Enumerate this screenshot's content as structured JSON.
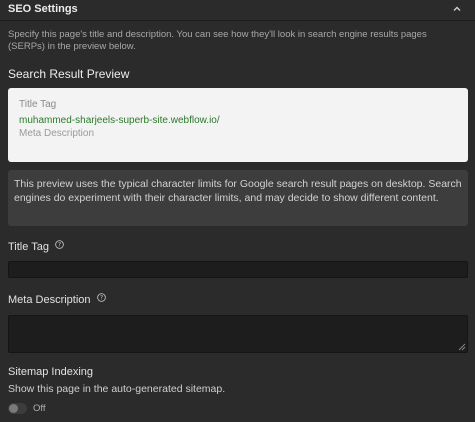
{
  "header": {
    "title": "SEO Settings",
    "collapse_icon": "chevron-up-icon"
  },
  "intro": {
    "text": "Specify this page's title and description. You can see how they'll look in search engine results pages (SERPs) in the preview below."
  },
  "preview": {
    "heading": "Search Result Preview",
    "title_tag": "Title Tag",
    "url": "muhammed-sharjeels-superb-site.webflow.io/",
    "meta_description": "Meta Description",
    "url_color": "#2a7a2a"
  },
  "note": {
    "text": "This preview uses the typical character limits for Google search result pages on desktop. Search engines do experiment with their character limits, and may decide to show different content."
  },
  "title_tag_field": {
    "label": "Title Tag",
    "value": "",
    "placeholder": "",
    "help_icon": "question-circle-icon"
  },
  "meta_description_field": {
    "label": "Meta Description",
    "value": "",
    "placeholder": "",
    "help_icon": "question-circle-icon"
  },
  "sitemap": {
    "title": "Sitemap Indexing",
    "description": "Show this page in the auto-generated sitemap.",
    "toggle_state": "Off",
    "enabled": false
  },
  "colors": {
    "background": "#2b2b2b",
    "input_background": "#1d1d1d",
    "preview_background": "#f3f3f3",
    "note_background": "#3d3d3d"
  }
}
